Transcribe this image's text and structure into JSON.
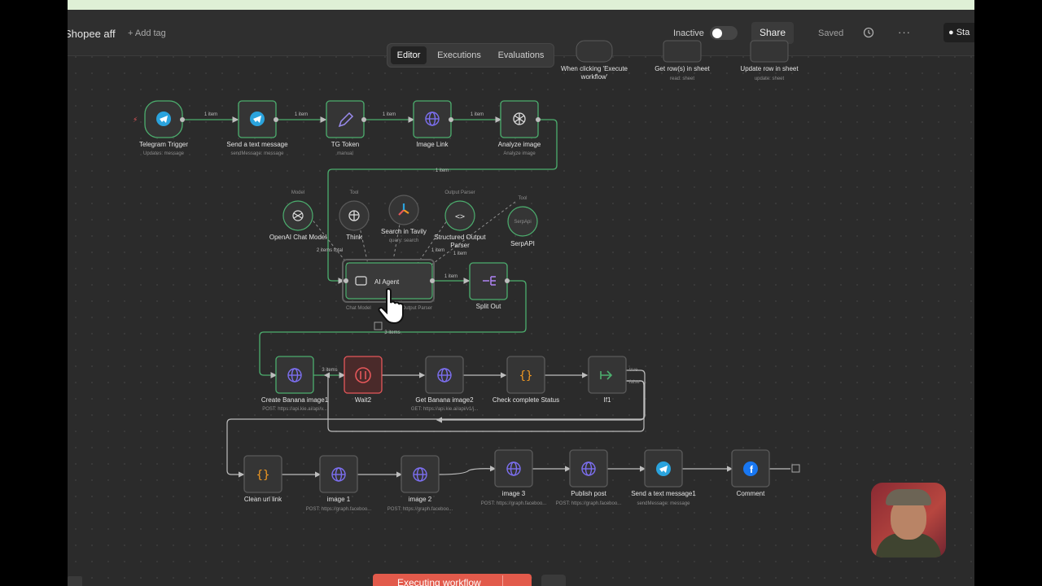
{
  "topbar": {
    "workflow_name": "Shopee aff",
    "add_tag": "+ Add tag",
    "active_label": "Inactive",
    "share_label": "Share",
    "saved_label": "Saved",
    "more_label": "···",
    "github_label": "Sta"
  },
  "tabs": [
    "Editor",
    "Executions",
    "Evaluations"
  ],
  "top_nodes": [
    {
      "label": "When clicking 'Execute",
      "label2": "workflow'"
    },
    {
      "label": "Get row(s) in sheet",
      "sub": "read: sheet"
    },
    {
      "label": "Update row in sheet",
      "sub": "update: sheet"
    }
  ],
  "nodes": {
    "telegram_trigger": {
      "label": "Telegram Trigger",
      "sub": "Updates: message"
    },
    "send_text": {
      "label": "Send a text message",
      "sub": "sendMessage: message"
    },
    "tg_token": {
      "label": "TG Token",
      "sub": "manual"
    },
    "image_link": {
      "label": "Image Link"
    },
    "analyze_image": {
      "label": "Analyze image",
      "sub": "Analyze image"
    },
    "openai_model": {
      "label": "OpenAI Chat Model",
      "tag": "Model"
    },
    "think": {
      "label": "Think",
      "tag": "Tool"
    },
    "tavily": {
      "label": "Search in Tavily",
      "sub": "query: search"
    },
    "output_parser": {
      "label": "Structured Output",
      "label2": "Parser",
      "tag": "Output Parser"
    },
    "serpapi": {
      "label": "SerpAPI",
      "tag": "Tool",
      "inner": "SerpApi"
    },
    "ai_agent": {
      "label": "AI Agent",
      "sub_left": "Chat Model",
      "sub_right": "Output Parser"
    },
    "split_out": {
      "label": "Split Out"
    },
    "create_banana": {
      "label": "Create Banana image1",
      "sub": "POST: https://api.kie.ai/api/v..."
    },
    "wait2": {
      "label": "Wait2"
    },
    "get_banana": {
      "label": "Get Banana image2",
      "sub": "GET: https://api.kie.ai/api/v1/j..."
    },
    "check_status": {
      "label": "Check complete Status"
    },
    "if1": {
      "label": "If1",
      "true_label": "true",
      "false_label": "false"
    },
    "clean_url": {
      "label": "Clean url link"
    },
    "image1": {
      "label": "image 1",
      "sub": "POST: https://graph.faceboo..."
    },
    "image2": {
      "label": "image 2",
      "sub": "POST: https://graph.faceboo..."
    },
    "image3": {
      "label": "image 3",
      "sub": "POST: https://graph.faceboo..."
    },
    "publish_post": {
      "label": "Publish post",
      "sub": "POST: https://graph.faceboo..."
    },
    "send_text1": {
      "label": "Send a text message1",
      "sub": "sendMessage: message"
    },
    "comment": {
      "label": "Comment"
    }
  },
  "edge_labels": {
    "one_item": "1 item",
    "two_items_total": "2 items total",
    "three_items": "3 items"
  },
  "bottom": {
    "execute_label": "Executing workflow"
  },
  "colors": {
    "success": "#4cae6e",
    "error": "#e5575a",
    "globe": "#7c6ff0",
    "telegram": "#2aa3dd",
    "code": "#f39a22",
    "facebook": "#1877f2"
  }
}
